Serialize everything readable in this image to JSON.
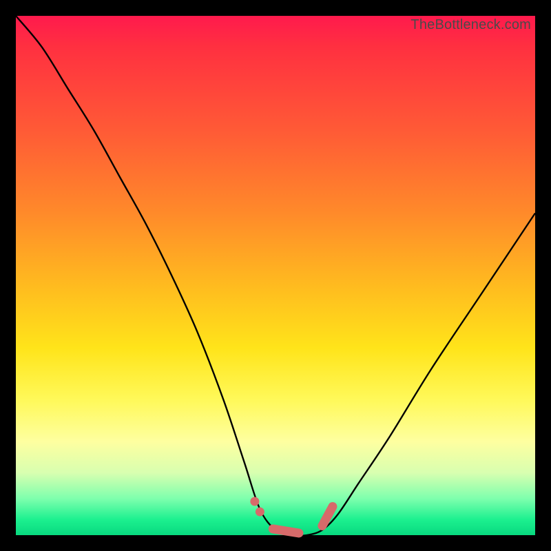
{
  "watermark": "TheBottleneck.com",
  "colors": {
    "frame": "#000000",
    "curve": "#000000",
    "marker": "#d76a6a"
  },
  "chart_data": {
    "type": "line",
    "title": "",
    "xlabel": "",
    "ylabel": "",
    "xlim": [
      0,
      100
    ],
    "ylim": [
      0,
      100
    ],
    "note": "Axes have no tick labels in the image; values are visual estimates on a 0–100 normalized scale. Y represents bottleneck % (higher = worse, red at top; green near 0 at bottom). The curve is a V/U shape with its minimum plateau around x≈48–60.",
    "series": [
      {
        "name": "bottleneck-curve",
        "x": [
          0,
          5,
          10,
          15,
          20,
          25,
          30,
          35,
          40,
          44,
          47,
          50,
          53,
          56,
          59,
          62,
          66,
          72,
          80,
          90,
          100
        ],
        "y": [
          100,
          94,
          86,
          78,
          69,
          60,
          50,
          39,
          26,
          14,
          5,
          1,
          0,
          0,
          1,
          4,
          10,
          19,
          32,
          47,
          62
        ]
      }
    ],
    "markers": {
      "name": "optimal-range",
      "note": "Salmon rounded markers highlighting the near-zero plateau at the bottom of the curve.",
      "x": [
        46,
        47,
        49.5,
        54.5,
        59,
        60,
        61
      ],
      "y": [
        6.5,
        4.5,
        1.2,
        0.4,
        1.8,
        3.2,
        5.5
      ]
    }
  }
}
